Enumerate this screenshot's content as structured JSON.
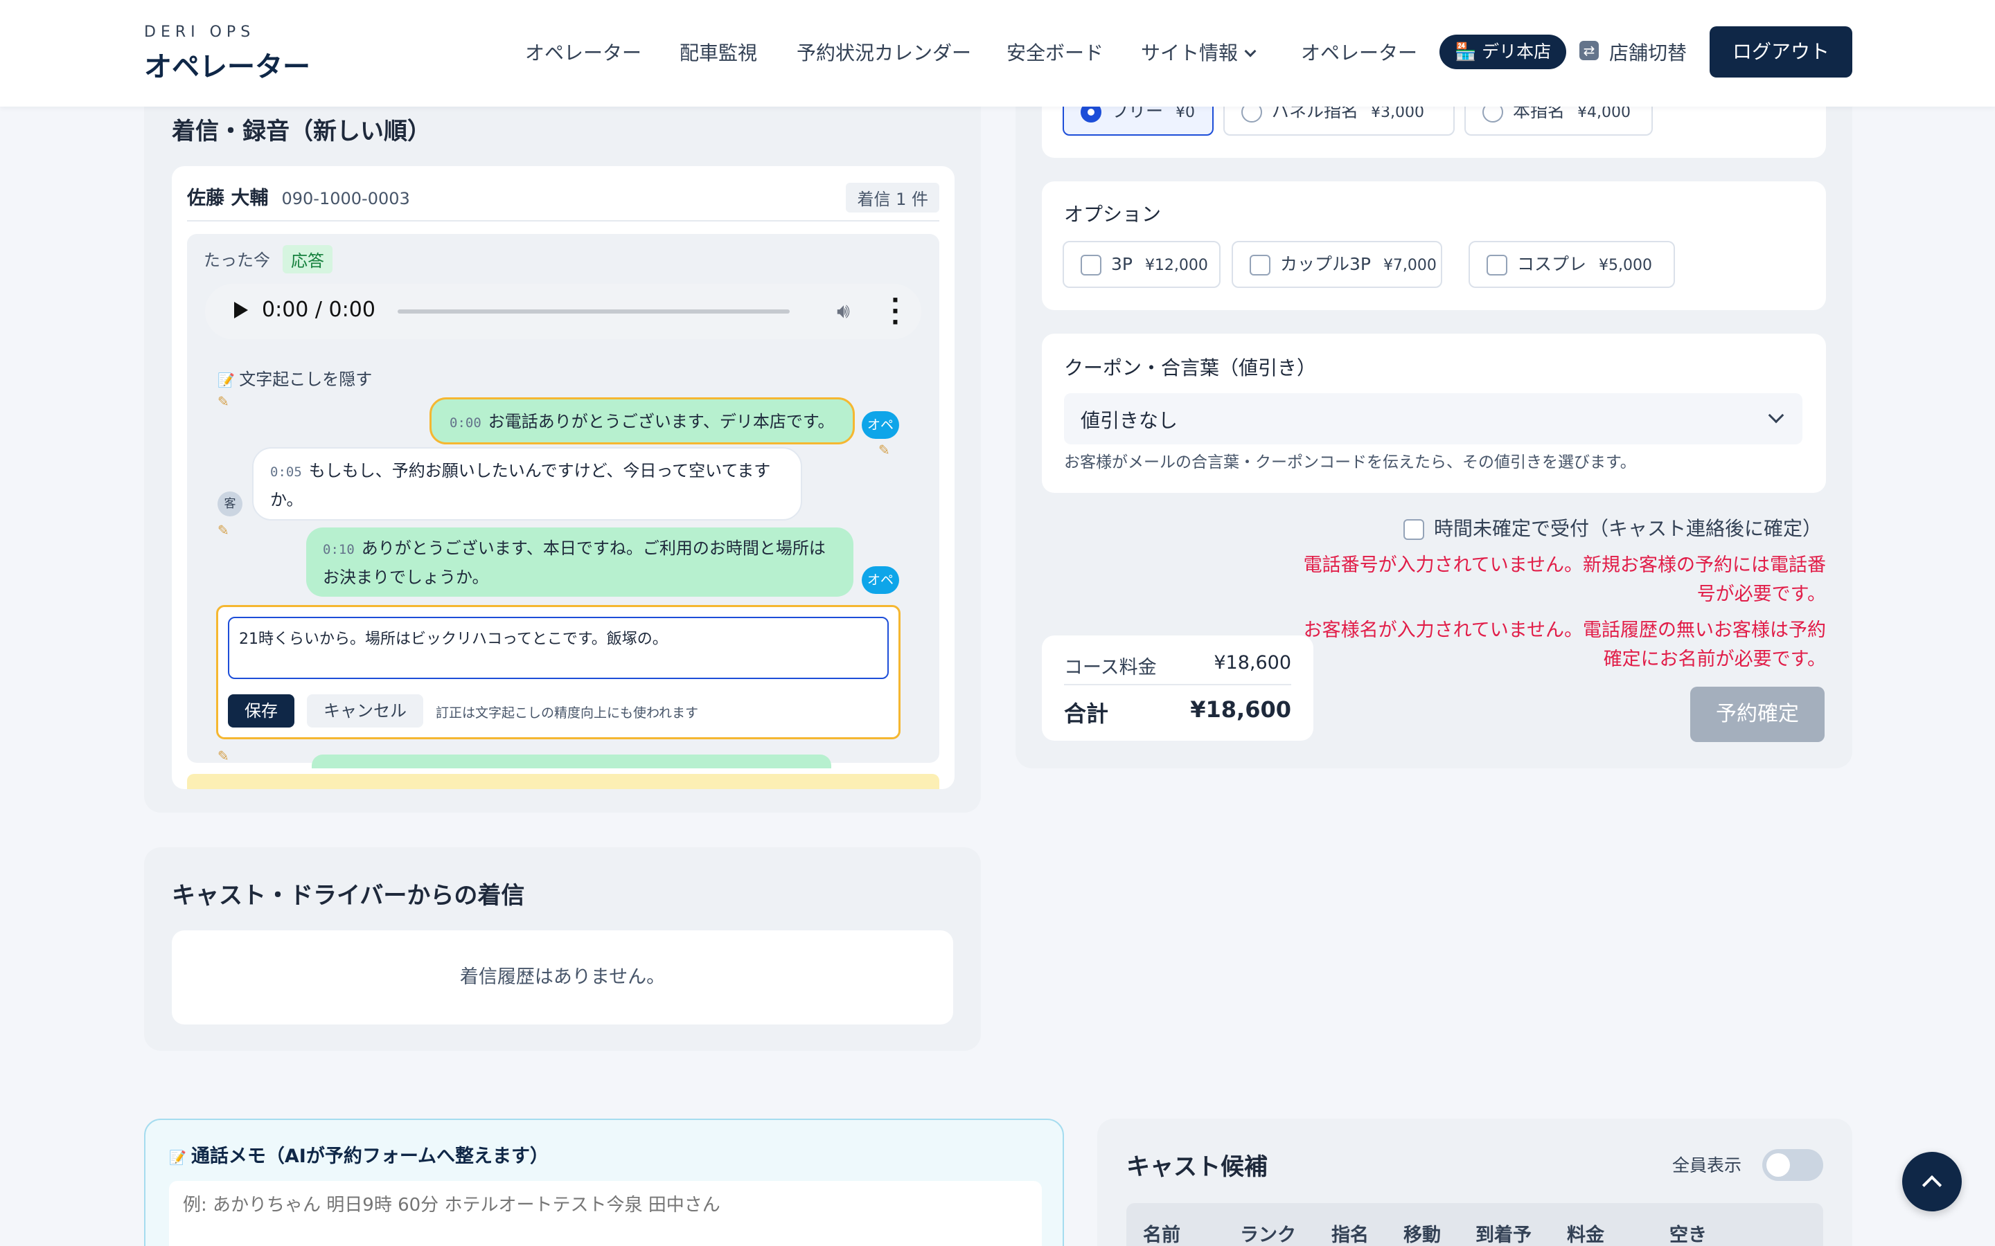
{
  "nav": {
    "brand_sub": "DERI OPS",
    "brand_title": "オペレーター",
    "items": [
      "オペレーター",
      "配車監視",
      "予約状況カレンダー",
      "安全ボード",
      "サイト情報",
      "オペレーター"
    ],
    "store_badge": "デリ本店",
    "switch_store": "店舗切替",
    "logout": "ログアウト"
  },
  "calls": {
    "title": "着信・録音（新しい順）",
    "caller_name": "佐藤 大輔",
    "caller_phone": "090-1000-0003",
    "count_badge": "着信 1 件",
    "time_ago": "たった今",
    "status": "応答",
    "audio_time": "0:00 / 0:00",
    "toggle_transcript": "文字起こしを隠す",
    "messages": [
      {
        "speaker": "オペ",
        "ts": "0:00",
        "text": "お電話ありがとうございます、デリ本店です。"
      },
      {
        "speaker": "客",
        "ts": "0:05",
        "text": "もしもし、予約お願いしたいんですけど、今日って空いてますか。"
      },
      {
        "speaker": "オペ",
        "ts": "0:10",
        "text": "ありがとうございます、本日ですね。ご利用のお時間と場所はお決まりでしょうか。"
      }
    ],
    "edit_value": "21時くらいから。場所はビックリハコってとこです。飯塚の。",
    "save": "保存",
    "cancel": "キャンセル",
    "edit_hint": "訂正は文字起こしの精度向上にも使われます"
  },
  "cast_calls": {
    "title": "キャスト・ドライバーからの着信",
    "empty": "着信履歴はありません。"
  },
  "memo": {
    "title": "通話メモ（AIが予約フォームへ整えます）",
    "placeholder": "例: あかりちゃん 明日9時 60分 ホテルオートテスト今泉 田中さん"
  },
  "nomination": {
    "options": [
      {
        "label": "フリー",
        "price": "¥0",
        "selected": true
      },
      {
        "label": "パネル指名",
        "price": "¥3,000",
        "selected": false
      },
      {
        "label": "本指名",
        "price": "¥4,000",
        "selected": false
      }
    ]
  },
  "options": {
    "title": "オプション",
    "items": [
      {
        "label": "3P",
        "price": "¥12,000"
      },
      {
        "label": "カップル3P",
        "price": "¥7,000"
      },
      {
        "label": "コスプレ",
        "price": "¥5,000"
      }
    ]
  },
  "coupon": {
    "title": "クーポン・合言葉（値引き）",
    "selected": "値引きなし",
    "hint": "お客様がメールの合言葉・クーポンコードを伝えたら、その値引きを選びます。"
  },
  "unconfirmed": "時間未確定で受付（キャスト連絡後に確定）",
  "errors": [
    "電話番号が入力されていません。新規お客様の予約には電話番号が必要です。",
    "お客様名が入力されていません。電話履歴の無いお客様は予約確定にお名前が必要です。"
  ],
  "totals": {
    "course_label": "コース料金",
    "course_value": "¥18,600",
    "total_label": "合計",
    "total_value": "¥18,600"
  },
  "confirm": "予約確定",
  "cast_list": {
    "title": "キャスト候補",
    "show_all": "全員表示",
    "show_all_on": false,
    "columns": [
      "名前",
      "ランク",
      "指名",
      "移動",
      "到着予",
      "料金",
      "空き"
    ]
  },
  "colors": {
    "navy": "#0f2747",
    "operator_bubble": "#b7f0cf",
    "operator_tag": "#0ea5e9",
    "error": "#e11d48",
    "highlight_border": "#f5b731"
  }
}
